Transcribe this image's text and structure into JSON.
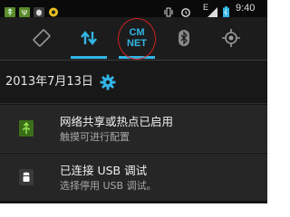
{
  "status_bar": {
    "time": "9:40",
    "signal_label": "E",
    "icons": [
      "usb-icon",
      "usb-debug-icon",
      "bug-icon",
      "android-icon",
      "vibrate-icon",
      "alarm-icon",
      "signal-icon",
      "battery-icon"
    ]
  },
  "quick_settings": {
    "tiles": [
      {
        "name": "auto-rotate",
        "icon": "rotate-icon",
        "active": false
      },
      {
        "name": "mobile-data",
        "icon": "data-arrows-icon",
        "active": true
      },
      {
        "name": "carrier",
        "label_line1": "CM",
        "label_line2": "NET",
        "active": true,
        "annotated": true
      },
      {
        "name": "bluetooth",
        "icon": "bluetooth-icon",
        "active": false
      },
      {
        "name": "gps",
        "icon": "gps-icon",
        "active": false
      }
    ],
    "accent_color": "#33b5e5"
  },
  "date_row": {
    "date": "2013年7月13日",
    "settings_icon": "gear-icon"
  },
  "notifications": [
    {
      "icon": "usb-tether-icon",
      "icon_color": "#8bd43a",
      "title": "网络共享或热点已启用",
      "subtitle": "触摸可进行配置"
    },
    {
      "icon": "android-bug-icon",
      "icon_color": "#ffffff",
      "title": "已连接 USB 调试",
      "subtitle": "选择停用 USB 调试。"
    }
  ],
  "annotation": {
    "shape": "circle",
    "color": "#d02020",
    "target": "carrier"
  }
}
